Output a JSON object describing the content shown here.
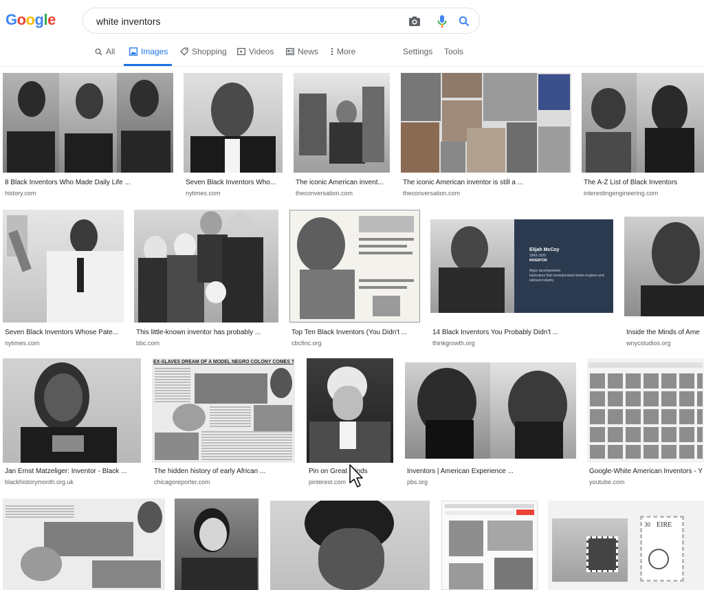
{
  "logo": {
    "letters": [
      "G",
      "o",
      "o",
      "g",
      "l",
      "e"
    ]
  },
  "search": {
    "value": "white inventors"
  },
  "tabs": [
    {
      "label": "All",
      "icon": "search-icon"
    },
    {
      "label": "Images",
      "icon": "image-icon"
    },
    {
      "label": "Shopping",
      "icon": "tag-icon"
    },
    {
      "label": "Videos",
      "icon": "play-icon"
    },
    {
      "label": "News",
      "icon": "news-icon"
    },
    {
      "label": "More",
      "icon": "more-vert-icon"
    }
  ],
  "tools": {
    "settings": "Settings",
    "tools": "Tools"
  },
  "results": [
    {
      "title": "8 Black Inventors Who Made Daily Life ...",
      "source": "history.com"
    },
    {
      "title": "Seven Black Inventors Who...",
      "source": "nytimes.com"
    },
    {
      "title": "The iconic American invent...",
      "source": "theconversation.com"
    },
    {
      "title": "The iconic American inventor is still a ...",
      "source": "theconversation.com"
    },
    {
      "title": "The A-Z List of Black Inventors",
      "source": "interestingengineering.com"
    },
    {
      "title": "Seven Black Inventors Whose Pate...",
      "source": "nytimes.com"
    },
    {
      "title": "This little-known inventor has probably ...",
      "source": "bbc.com"
    },
    {
      "title": "Top Ten Black Inventors (You Didn't ...",
      "source": "cbcfinc.org"
    },
    {
      "title": "14 Black Inventors You Probably Didn't ...",
      "source": "thinkgrowth.org"
    },
    {
      "title": "Inside the Minds of Ame",
      "source": "wnycstudios.org"
    },
    {
      "title": "Jan Ernst Matzeliger: Inventor - Black ...",
      "source": "blackhistorymonth.org.uk"
    },
    {
      "title": "The hidden history of early African ...",
      "source": "chicagoreporter.com"
    },
    {
      "title": "Pin on Great Minds",
      "source": "pinterest.com"
    },
    {
      "title": "Inventors | American Experience ...",
      "source": "pbs.org"
    },
    {
      "title": "Google-White American Inventors - Y",
      "source": "youtube.com"
    }
  ],
  "thumb_text": {
    "mccoy_name": "Elijah McCoy",
    "mccoy_years": "1843-1929",
    "mccoy_role": "INVENTOR",
    "mccoy_dev": "Major developments:",
    "mccoy_desc": "lubricators that revolutionized steam engines and railroad industry",
    "newspaper_headline": "EX-SLAVES DREAM OF A MODEL NEGRO COLONY COMES TRUE",
    "stamp_eire": "EIRE",
    "stamp_value": "30"
  },
  "colors": {
    "accent": "#1a73e8",
    "mccoy_panel": "#2b3a4f"
  }
}
